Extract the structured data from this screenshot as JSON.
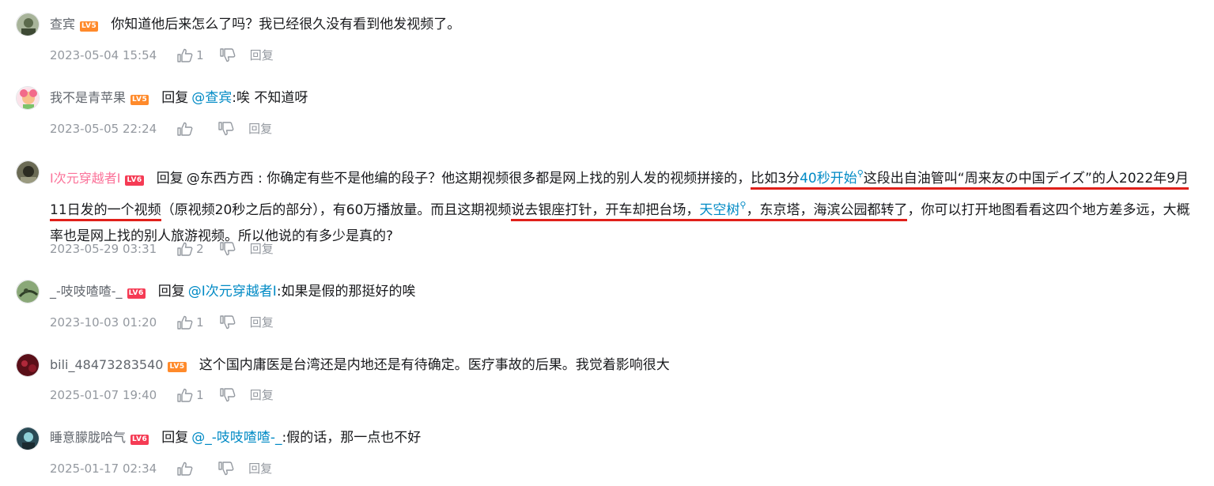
{
  "comments": [
    {
      "username": "查宾",
      "level": "LV5",
      "text": "你知道他后来怎么了吗？我已经很久没有看到他发视频了。",
      "time": "2023-05-04 15:54",
      "likes": "1",
      "reply_label": "回复",
      "avatar_color": "#7c8a6a"
    },
    {
      "username": "我不是青苹果",
      "level": "LV5",
      "reply_word": "回复",
      "reply_to": "@查宾",
      "text": ":唉 不知道呀",
      "time": "2023-05-05 22:24",
      "likes": "",
      "reply_label": "回复",
      "avatar_color": "#f2b7c6"
    },
    {
      "username": "I次元穿越者I",
      "level": "LV6",
      "reply_word": "回复",
      "reply_to_plain": "@东西方西",
      "segments": {
        "s1": " : 你确定有些不是他编的段子？他这期视频很多都是网上找的别人发的视频拼接的，",
        "s2": "比如3分",
        "s3": "40秒开始",
        "s4": "这段出自油管叫“周来友の中国デイズ”",
        "s5": "的人2022年9月11日发的一个视频",
        "s6": "（原视频20秒之后的部分），有60万播放量。而且这期视频",
        "s7": "说去银座打针，开车却把台场，",
        "s8": "天空树",
        "s9": "，东京塔，海滨公园都转了",
        "s10": "，你可以打开地图看看这四个地方差多远，大概率也是网上找的别人旅游视频。所以他说的有多少是真的?"
      },
      "time": "2023-05-29 03:31",
      "likes": "2",
      "reply_label": "回复",
      "avatar_color": "#4a4a3a"
    },
    {
      "username": "_-吱吱喳喳-_",
      "level": "LV6",
      "reply_word": "回复",
      "reply_to": "@I次元穿越者I",
      "text": ":如果是假的那挺好的唉",
      "time": "2023-10-03 01:20",
      "likes": "1",
      "reply_label": "回复",
      "avatar_color": "#5a7a4a"
    },
    {
      "username": "bili_48473283540",
      "level": "LV5",
      "text": "这个国内庸医是台湾还是内地还是有待确定。医疗事故的后果。我觉着影响很大",
      "time": "2025-01-07 19:40",
      "likes": "1",
      "reply_label": "回复",
      "avatar_color": "#6a1a22"
    },
    {
      "username": "睡意朦胧哈气",
      "level": "LV6",
      "reply_word": "回复",
      "reply_to": "@_-吱吱喳喳-_",
      "text": ":假的话，那一点也不好",
      "time": "2025-01-17 02:34",
      "likes": "",
      "reply_label": "回复",
      "avatar_color": "#3a6a7a"
    }
  ],
  "colors": {
    "link": "#008ac5",
    "underline": "#e0201a",
    "meta": "#9499a0",
    "level_orange": "#ff8a2b",
    "level_red": "#f53b54"
  },
  "icons": {
    "like": "thumbs-up-icon",
    "dislike": "thumbs-down-icon",
    "search": "search-icon"
  }
}
